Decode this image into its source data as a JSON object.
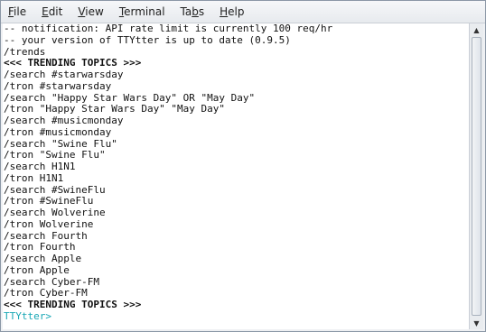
{
  "menu": {
    "file": {
      "mnemonic": "F",
      "rest": "ile"
    },
    "edit": {
      "mnemonic": "E",
      "rest": "dit"
    },
    "view": {
      "mnemonic": "V",
      "rest": "iew"
    },
    "terminal": {
      "mnemonic": "T",
      "rest": "erminal"
    },
    "tabs": {
      "pre": "Ta",
      "mnemonic": "b",
      "rest": "s"
    },
    "help": {
      "mnemonic": "H",
      "rest": "elp"
    }
  },
  "terminal": {
    "lines": [
      "-- notification: API rate limit is currently 100 req/hr",
      "-- your version of TTYtter is up to date (0.9.5)",
      "/trends",
      "<<< TRENDING TOPICS >>>",
      "/search #starwarsday",
      "/tron #starwarsday",
      "/search \"Happy Star Wars Day\" OR \"May Day\"",
      "/tron \"Happy Star Wars Day\" \"May Day\"",
      "/search #musicmonday",
      "/tron #musicmonday",
      "/search \"Swine Flu\"",
      "/tron \"Swine Flu\"",
      "/search H1N1",
      "/tron H1N1",
      "/search #SwineFlu",
      "/tron #SwineFlu",
      "/search Wolverine",
      "/tron Wolverine",
      "/search Fourth",
      "/tron Fourth",
      "/search Apple",
      "/tron Apple",
      "/search Cyber-FM",
      "/tron Cyber-FM",
      "<<< TRENDING TOPICS >>>"
    ],
    "prompt": "TTYtter>"
  },
  "scrollbar": {
    "up_icon": "arrow-up-icon",
    "down_icon": "arrow-down-icon"
  }
}
